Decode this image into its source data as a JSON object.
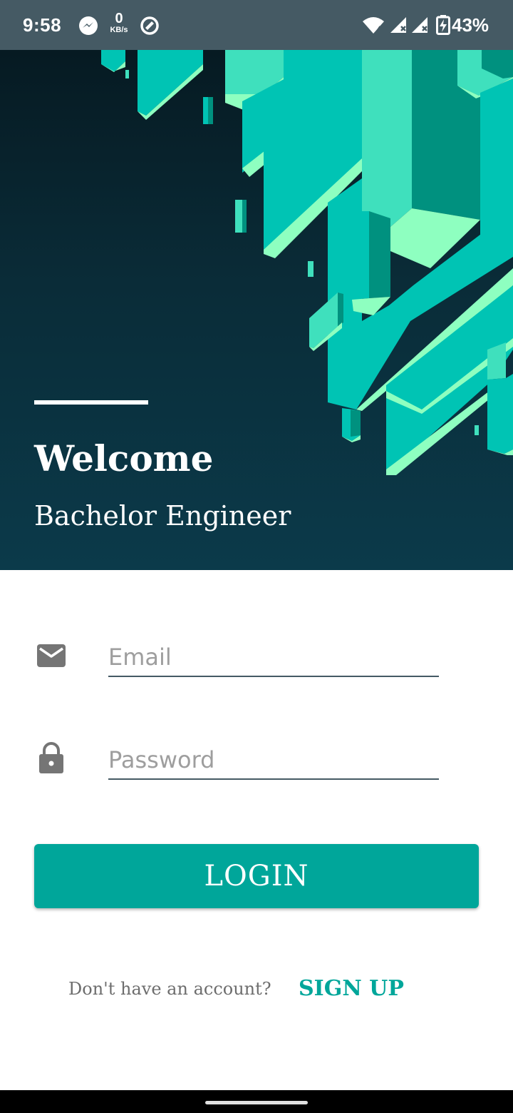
{
  "status_bar": {
    "time": "9:58",
    "net_speed_value": "0",
    "net_speed_unit": "KB/s",
    "battery_percent": "43%",
    "icons": [
      "messenger-icon",
      "data-saver-icon",
      "wifi-icon",
      "signal-icon",
      "signal-icon",
      "battery-charging-icon"
    ]
  },
  "header": {
    "title": "Welcome",
    "subtitle": "Bachelor Engineer"
  },
  "form": {
    "email_placeholder": "Email",
    "email_value": "",
    "password_placeholder": "Password",
    "password_value": "",
    "login_label": "LOGIN"
  },
  "footer": {
    "no_account_text": "Don't have an account?",
    "signup_label": "SIGN UP"
  },
  "colors": {
    "accent": "#00a69a",
    "header_dark": "#061a22",
    "status_bar": "#455a64",
    "art_light": "#8effc0",
    "art_mid": "#00c4b4",
    "art_dark": "#00917f"
  }
}
